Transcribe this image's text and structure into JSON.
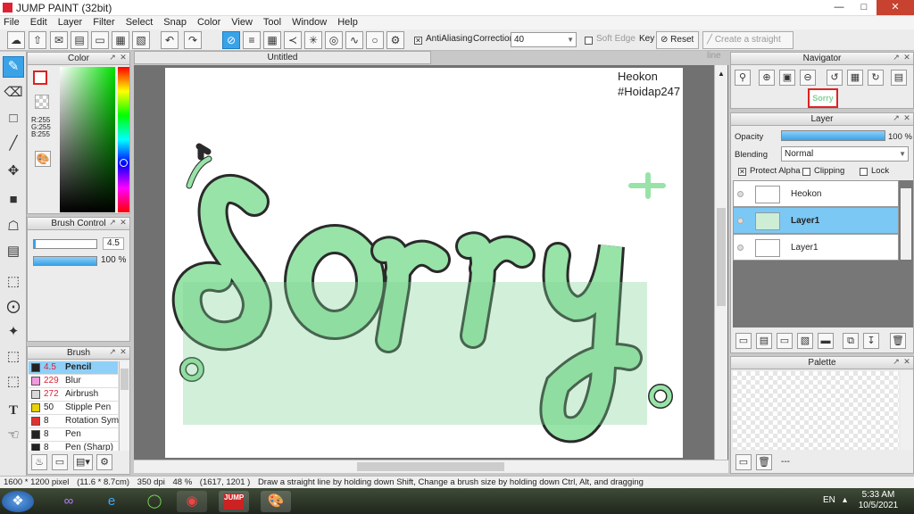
{
  "window": {
    "title": "JUMP PAINT (32bit)"
  },
  "menu": [
    "File",
    "Edit",
    "Layer",
    "Filter",
    "Select",
    "Snap",
    "Color",
    "View",
    "Tool",
    "Window",
    "Help"
  ],
  "toolbar": {
    "antialiasing_label": "AntiAliasing",
    "correction_label": "Correction",
    "correction_value": "40",
    "soft_edge_label": "Soft Edge",
    "key_label": "Key",
    "reset_label": "Reset",
    "straight_line_label": "Create a straight line"
  },
  "color_panel": {
    "title": "Color",
    "r": "R:255",
    "g": "G:255",
    "b": "B:255"
  },
  "brush_control": {
    "title": "Brush Control",
    "size_value": "4.5",
    "opacity_value": "100 %"
  },
  "brush_panel": {
    "title": "Brush",
    "items": [
      {
        "size": "4.5",
        "name": "Pencil",
        "swatch": "#222222"
      },
      {
        "size": "229",
        "name": "Blur",
        "swatch": "#f29ae0"
      },
      {
        "size": "272",
        "name": "Airbrush",
        "swatch": "#d8d8d8"
      },
      {
        "size": "50",
        "name": "Stipple Pen",
        "swatch": "#e8d200"
      },
      {
        "size": "8",
        "name": "Rotation Symm",
        "swatch": "#e03131"
      },
      {
        "size": "8",
        "name": "Pen",
        "swatch": "#222222"
      },
      {
        "size": "8",
        "name": "Pen (Sharp)",
        "swatch": "#222222"
      }
    ]
  },
  "canvas": {
    "tab_title": "Untitled",
    "credit_line1": "Heokon",
    "credit_line2": "#Hoidap247",
    "artwork_text": "Sorry"
  },
  "navigator": {
    "title": "Navigator"
  },
  "layer_panel": {
    "title": "Layer",
    "opacity_label": "Opacity",
    "opacity_value": "100 %",
    "opacity_fraction": 1.0,
    "blending_label": "Blending",
    "blending_value": "Normal",
    "protect_alpha_label": "Protect Alpha",
    "clipping_label": "Clipping",
    "lock_label": "Lock",
    "layers": [
      {
        "name": "Heokon",
        "selected": false
      },
      {
        "name": "Layer1",
        "selected": true
      },
      {
        "name": "Layer1",
        "selected": false
      }
    ]
  },
  "palette": {
    "title": "Palette",
    "more": "---"
  },
  "status": {
    "size": "1600 * 1200 pixel",
    "physical": "(11.6 * 8.7cm)",
    "dpi": "350 dpi",
    "zoom": "48 %",
    "coords": "(1617, 1201 )",
    "hint": "Draw a straight line by holding down Shift, Change a brush size by holding down Ctrl, Alt, and dragging"
  },
  "taskbar": {
    "lang": "EN",
    "time": "5:33 AM",
    "date": "10/5/2021"
  },
  "colors": {
    "accent": "#3aa3e8",
    "lettering_fill": "#98e3a8",
    "lettering_shade": "#7fd194",
    "ink": "#2a2a2a"
  }
}
